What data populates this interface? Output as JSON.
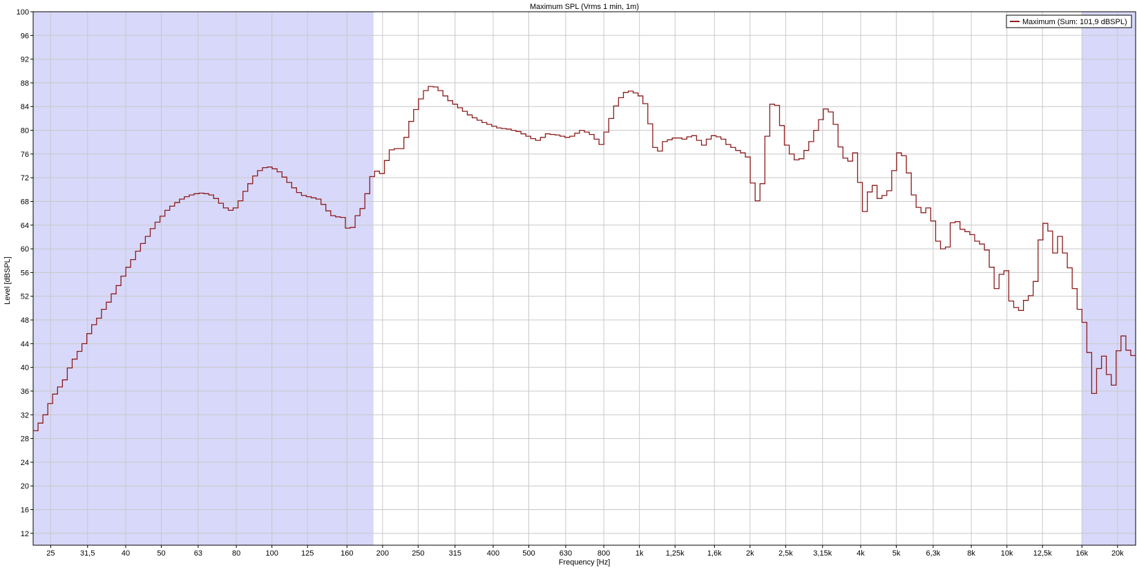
{
  "chart_data": {
    "type": "line",
    "title": "Maximum SPL (Vrms 1 min, 1m)",
    "xlabel": "Frequency [Hz]",
    "ylabel": "Level [dBSPL]",
    "x_scale": "log",
    "xlim": [
      22.4,
      22400
    ],
    "ylim": [
      10,
      100
    ],
    "yticks": [
      12,
      16,
      20,
      24,
      28,
      32,
      36,
      40,
      44,
      48,
      52,
      56,
      60,
      64,
      68,
      72,
      76,
      80,
      84,
      88,
      92,
      96,
      100
    ],
    "xticks": [
      {
        "value": 25,
        "label": "25"
      },
      {
        "value": 31.5,
        "label": "31,5"
      },
      {
        "value": 40,
        "label": "40"
      },
      {
        "value": 50,
        "label": "50"
      },
      {
        "value": 63,
        "label": "63"
      },
      {
        "value": 80,
        "label": "80"
      },
      {
        "value": 100,
        "label": "100"
      },
      {
        "value": 125,
        "label": "125"
      },
      {
        "value": 160,
        "label": "160"
      },
      {
        "value": 200,
        "label": "200"
      },
      {
        "value": 250,
        "label": "250"
      },
      {
        "value": 315,
        "label": "315"
      },
      {
        "value": 400,
        "label": "400"
      },
      {
        "value": 500,
        "label": "500"
      },
      {
        "value": 630,
        "label": "630"
      },
      {
        "value": 800,
        "label": "800"
      },
      {
        "value": 1000,
        "label": "1k"
      },
      {
        "value": 1250,
        "label": "1,25k"
      },
      {
        "value": 1600,
        "label": "1,6k"
      },
      {
        "value": 2000,
        "label": "2k"
      },
      {
        "value": 2500,
        "label": "2,5k"
      },
      {
        "value": 3150,
        "label": "3,15k"
      },
      {
        "value": 4000,
        "label": "4k"
      },
      {
        "value": 5000,
        "label": "5k"
      },
      {
        "value": 6300,
        "label": "6,3k"
      },
      {
        "value": 8000,
        "label": "8k"
      },
      {
        "value": 10000,
        "label": "10k"
      },
      {
        "value": 12500,
        "label": "12,5k"
      },
      {
        "value": 16000,
        "label": "16k"
      },
      {
        "value": 20000,
        "label": "20k"
      }
    ],
    "shaded_ranges": [
      [
        22.4,
        189
      ],
      [
        16000,
        22400
      ]
    ],
    "grid": true,
    "legend_position": "top-right",
    "series": [
      {
        "name": "Maximum (Sum: 101,9 dBSPL)",
        "color": "#8b1a1a",
        "step": true,
        "levels": [
          29.3,
          30.6,
          32.0,
          33.9,
          35.5,
          36.7,
          37.9,
          39.9,
          41.4,
          42.7,
          44.0,
          45.7,
          47.2,
          48.3,
          49.8,
          51.0,
          52.4,
          53.8,
          55.4,
          56.9,
          58.2,
          59.6,
          60.9,
          62.1,
          63.4,
          64.5,
          65.5,
          66.5,
          67.2,
          67.8,
          68.4,
          68.8,
          69.1,
          69.3,
          69.4,
          69.3,
          69.1,
          68.5,
          67.7,
          66.9,
          66.5,
          66.9,
          68.1,
          69.7,
          71.0,
          72.3,
          73.2,
          73.7,
          73.8,
          73.5,
          73.0,
          72.1,
          71.2,
          70.3,
          69.5,
          69.0,
          68.8,
          68.6,
          68.4,
          67.5,
          66.4,
          65.6,
          65.4,
          65.3,
          63.5,
          63.6,
          65.6,
          66.8,
          69.3,
          72.2,
          73.1,
          72.7,
          74.9,
          76.7,
          76.9,
          76.9,
          78.8,
          81.5,
          83.5,
          85.3,
          86.7,
          87.4,
          87.3,
          86.7,
          85.8,
          85.0,
          84.4,
          83.8,
          83.2,
          82.6,
          82.1,
          81.7,
          81.3,
          81.0,
          80.7,
          80.4,
          80.3,
          80.2,
          80.0,
          79.8,
          79.4,
          79.0,
          78.6,
          78.3,
          78.8,
          79.4,
          79.3,
          79.2,
          79.0,
          78.8,
          79.0,
          79.5,
          80.0,
          79.7,
          79.3,
          78.5,
          77.6,
          79.7,
          82.0,
          84.1,
          85.5,
          86.4,
          86.6,
          86.3,
          85.8,
          84.5,
          81.1,
          77.1,
          76.5,
          78.1,
          78.4,
          78.7,
          78.7,
          78.5,
          78.9,
          79.1,
          78.3,
          77.5,
          78.5,
          79.1,
          78.9,
          78.5,
          77.6,
          77.1,
          76.6,
          76.2,
          75.5,
          71.1,
          68.1,
          71.0,
          79.0,
          84.4,
          84.2,
          80.8,
          77.5,
          76.0,
          75.0,
          75.2,
          76.6,
          78.1,
          80.0,
          81.8,
          83.6,
          83.1,
          81.0,
          77.2,
          75.3,
          74.8,
          76.2,
          71.2,
          66.3,
          69.6,
          70.7,
          68.5,
          69.0,
          69.8,
          73.2,
          76.2,
          75.7,
          72.8,
          69.1,
          67.0,
          66.1,
          66.9,
          64.7,
          61.3,
          60.0,
          60.3,
          64.4,
          64.6,
          63.3,
          62.9,
          62.4,
          61.3,
          60.8,
          59.8,
          56.9,
          53.3,
          55.7,
          56.3,
          51.2,
          50.1,
          49.6,
          51.3,
          52.1,
          54.5,
          61.5,
          64.3,
          63.0,
          59.3,
          62.1,
          59.3,
          56.8,
          53.3,
          49.8,
          47.6,
          42.5,
          35.6,
          39.8,
          41.9,
          38.8,
          37.0,
          42.8,
          45.3,
          42.9,
          42.0
        ]
      }
    ]
  }
}
